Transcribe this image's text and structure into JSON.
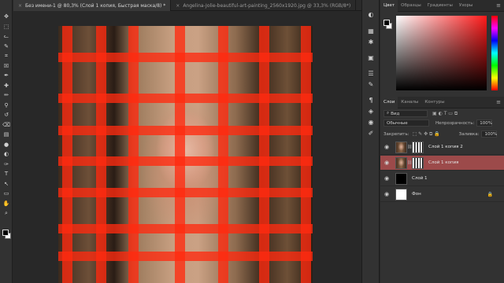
{
  "tabs": [
    {
      "label": "Без имени-1 @ 80,3% (Слой 1 копия, Быстрая маска/8) *",
      "active": true
    },
    {
      "label": "Angelina-Jolie-beautiful-art-painting_2560x1920.jpg @ 33,3% (RGB/8*)",
      "active": false
    }
  ],
  "close_symbol": "×",
  "toolbar": {
    "icons": [
      "move-icon",
      "marquee-icon",
      "lasso-icon",
      "quick-select-icon",
      "crop-icon",
      "frame-icon",
      "eyedropper-icon",
      "healing-icon",
      "brush-icon",
      "stamp-icon",
      "history-brush-icon",
      "eraser-icon",
      "gradient-icon",
      "blur-icon",
      "dodge-icon",
      "pen-icon",
      "type-icon",
      "path-select-icon",
      "shape-icon",
      "hand-icon",
      "zoom-icon"
    ],
    "glyphs": [
      "✥",
      "⬚",
      "ᓚ",
      "✎",
      "⌗",
      "☒",
      "✒",
      "✚",
      "✏",
      "⚲",
      "↺",
      "⌫",
      "▤",
      "●",
      "◐",
      "✑",
      "T",
      "↖",
      "▭",
      "✋",
      "⌕",
      "⋯"
    ]
  },
  "side_strip_icons": [
    {
      "name": "color-panel-icon",
      "glyph": "◐"
    },
    {
      "name": "swatches-panel-icon",
      "glyph": "▦"
    },
    {
      "name": "adjustments-panel-icon",
      "glyph": "✱"
    },
    {
      "name": "libraries-panel-icon",
      "glyph": "▣"
    },
    {
      "name": "history-panel-icon",
      "glyph": "☰"
    },
    {
      "name": "brush-settings-icon",
      "glyph": "✎"
    },
    {
      "name": "paragraph-panel-icon",
      "glyph": "¶"
    },
    {
      "name": "layers-panel-icon",
      "glyph": "◈"
    },
    {
      "name": "channels-panel-icon",
      "glyph": "◉"
    },
    {
      "name": "paths-panel-icon",
      "glyph": "✐"
    }
  ],
  "color_panel": {
    "tabs": [
      "Цвет",
      "Образцы",
      "Градиенты",
      "Узоры"
    ],
    "menu": "≡",
    "hue_color": "#ff1a1a"
  },
  "layers_panel": {
    "tabs": [
      "Слои",
      "Каналы",
      "Контуры"
    ],
    "menu": "≡",
    "filter_label": "Вид",
    "blend_mode": "Обычные",
    "opacity_label": "Непрозрачность:",
    "opacity_value": "100%",
    "lock_label": "Закрепить:",
    "fill_label": "Заливка:",
    "fill_value": "100%",
    "layers": [
      {
        "name": "Слой 1 копия 2",
        "thumb": "portrait",
        "mask": true,
        "selected": false
      },
      {
        "name": "Слой 1 копия",
        "thumb": "portrait",
        "mask": true,
        "selected": true
      },
      {
        "name": "Слой 1",
        "thumb": "black",
        "mask": false,
        "selected": false
      },
      {
        "name": "Фон",
        "thumb": "white",
        "mask": false,
        "selected": false,
        "locked": true
      }
    ]
  },
  "overlay_color": "#ff2a10"
}
